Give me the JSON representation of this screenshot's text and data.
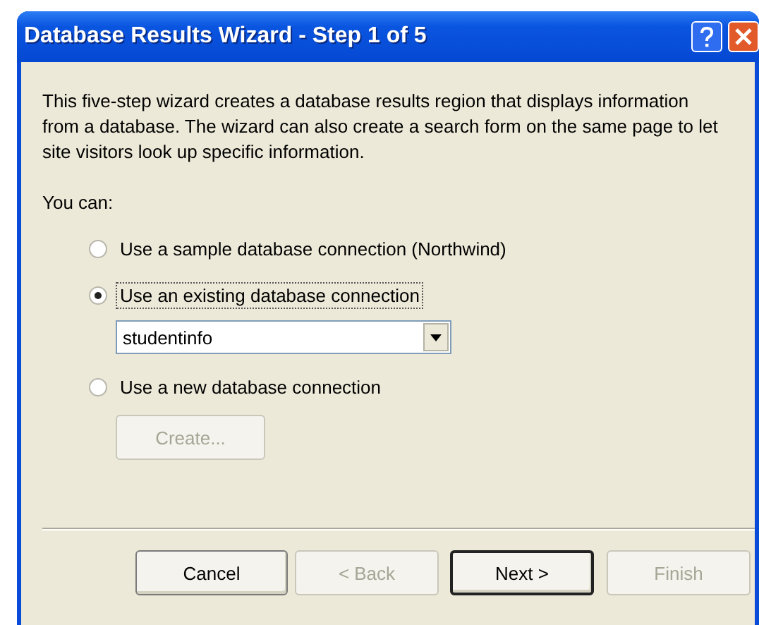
{
  "window": {
    "title": "Database Results Wizard - Step 1 of 5"
  },
  "intro": "This five-step wizard creates a database results region that displays information from a database. The wizard can also create a search form on the same page to let site visitors look up specific information.",
  "prompt": "You can:",
  "options": [
    {
      "label": "Use a sample database connection (Northwind)",
      "selected": false
    },
    {
      "label": "Use an existing database connection",
      "selected": true,
      "dropdown": {
        "value": "studentinfo"
      }
    },
    {
      "label": "Use a new database connection",
      "selected": false,
      "button": {
        "label": "Create...",
        "disabled": true
      }
    }
  ],
  "buttons": [
    {
      "label": "Cancel",
      "disabled": false,
      "default": false
    },
    {
      "label": "< Back",
      "disabled": true,
      "default": false
    },
    {
      "label": "Next >",
      "disabled": false,
      "default": true
    },
    {
      "label": "Finish",
      "disabled": true,
      "default": false
    }
  ]
}
